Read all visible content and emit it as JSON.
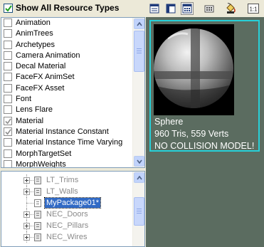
{
  "filter": {
    "show_all_label": "Show All Resource Types",
    "show_all_checked": true
  },
  "resource_types": [
    {
      "label": "Animation",
      "checked": false
    },
    {
      "label": "AnimTrees",
      "checked": false
    },
    {
      "label": "Archetypes",
      "checked": false
    },
    {
      "label": "Camera Animation",
      "checked": false
    },
    {
      "label": "Decal Material",
      "checked": false
    },
    {
      "label": "FaceFX AnimSet",
      "checked": false
    },
    {
      "label": "FaceFX Asset",
      "checked": false
    },
    {
      "label": "Font",
      "checked": false
    },
    {
      "label": "Lens Flare",
      "checked": false
    },
    {
      "label": "Material",
      "checked": true
    },
    {
      "label": "Material Instance Constant",
      "checked": true
    },
    {
      "label": "Material Instance Time Varying",
      "checked": false
    },
    {
      "label": "MorphTargetSet",
      "checked": false
    },
    {
      "label": "MorphWeights",
      "checked": false
    }
  ],
  "packages": [
    {
      "name": "LT_Trims",
      "expandable": true,
      "selected": false
    },
    {
      "name": "LT_Walls",
      "expandable": true,
      "selected": false
    },
    {
      "name": "MyPackage01*",
      "expandable": false,
      "selected": true
    },
    {
      "name": "NEC_Doors",
      "expandable": true,
      "selected": false
    },
    {
      "name": "NEC_Pillars",
      "expandable": true,
      "selected": false
    },
    {
      "name": "NEC_Wires",
      "expandable": true,
      "selected": false
    }
  ],
  "toolbar": {
    "icons": [
      "list-view-icon",
      "split-view-icon",
      "thumbnail-view-icon",
      "grid-options-icon",
      "paint-bucket-icon",
      "actual-size-icon"
    ],
    "pressed": "thumbnail-view-icon",
    "actual_size_label": "1:1"
  },
  "preview": {
    "name": "Sphere",
    "stats": "960 Tris, 559 Verts",
    "warning": "NO COLLISION MODEL!",
    "selection_color": "#27d0d8",
    "background_color": "#5b6c60"
  }
}
